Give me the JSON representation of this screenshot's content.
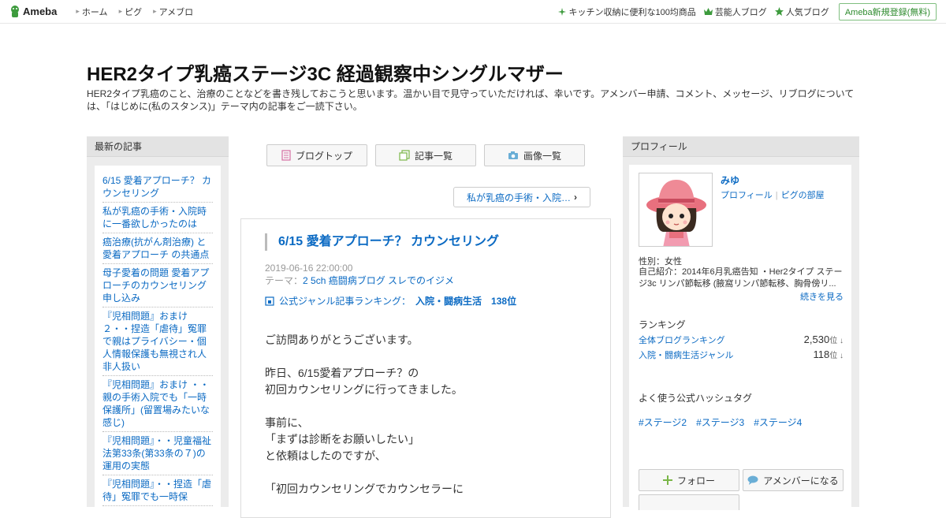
{
  "topbar": {
    "logo": "Ameba",
    "nav": [
      "ホーム",
      "ピグ",
      "アメブロ"
    ],
    "right": [
      {
        "label": "キッチン収納に便利な100均商品",
        "icon": "sparkle-icon"
      },
      {
        "label": "芸能人ブログ",
        "icon": "crown-icon"
      },
      {
        "label": "人気ブログ",
        "icon": "star-icon"
      }
    ],
    "register": "Ameba新規登録(無料)"
  },
  "header": {
    "title": "HER2タイプ乳癌ステージ3C 経過観察中シングルマザー",
    "description": "HER2タイプ乳癌のこと、治療のことなどを書き残しておこうと思います。温かい目で見守っていただければ、幸いです。アメンバー申請、コメント、メッセージ、リブログについては、「はじめに(私のスタンス)」テーマ内の記事をご一読下さい。"
  },
  "sidebar_left": {
    "heading": "最新の記事",
    "entries": [
      "6/15 愛着アプローチ？ カウンセリング",
      "私が乳癌の手術・入院時に一番欲しかったのは",
      "癌治療(抗がん剤治療) と 愛着アプローチ の共通点",
      "母子愛着の問題 愛着アプローチのカウンセリング申し込み",
      "『児相問題』おまけ２・・捏造「虐待」冤罪で親はプライバシー・個人情報保護も無視され人非人扱い",
      "『児相問題』おまけ ・・親の手術入院でも「一時保護所」(留置場みたいな感じ)",
      "『児相問題』・・児童福祉法第33条(第33条の７)の運用の実態",
      "『児相問題』・・捏造「虐待」冤罪でも一時保"
    ]
  },
  "tabs": [
    {
      "label": "ブログトップ",
      "icon": "document-icon"
    },
    {
      "label": "記事一覧",
      "icon": "copy-icon"
    },
    {
      "label": "画像一覧",
      "icon": "camera-icon"
    }
  ],
  "next_link": "私が乳癌の手術・入院…",
  "article": {
    "title": "6/15 愛着アプローチ？ カウンセリング",
    "date": "2019-06-16 22:00:00",
    "theme_label": "テーマ：",
    "theme": "2 5ch 癌闘病ブログ スレでのイジメ",
    "ranking_label": "公式ジャンル記事ランキング：",
    "ranking_genre": "入院・闘病生活　138位",
    "body": [
      "ご訪問ありがとうございます。",
      "",
      "昨日、6/15愛着アプローチ？の",
      "初回カウンセリングに行ってきました。",
      "",
      "事前に、",
      "「まずは診断をお願いしたい」",
      "と依頼はしたのですが、",
      "",
      "「初回カウンセリングでカウンセラーに"
    ]
  },
  "profile": {
    "heading": "プロフィール",
    "name": "みゆ",
    "links": [
      "プロフィール",
      "ピグの部屋"
    ],
    "gender": "性別：女性",
    "intro": "自己紹介：2014年6月乳癌告知 ・Her2タイプ ステージ3c リンパ節転移 (腋窩リンパ節転移、胸骨傍リ...",
    "more": "続きを見る",
    "ranking_heading": "ランキング",
    "rankings": [
      {
        "label": "全体ブログランキング",
        "value": "2,530",
        "unit": "位 ↓"
      },
      {
        "label": "入院・闘病生活ジャンル",
        "value": "118",
        "unit": "位 ↓"
      }
    ],
    "hashtag_heading": "よく使う公式ハッシュタグ",
    "hashtags": [
      "#ステージ2",
      "#ステージ3",
      "#ステージ4"
    ],
    "follow": "フォロー",
    "amember": "アメンバーになる"
  }
}
